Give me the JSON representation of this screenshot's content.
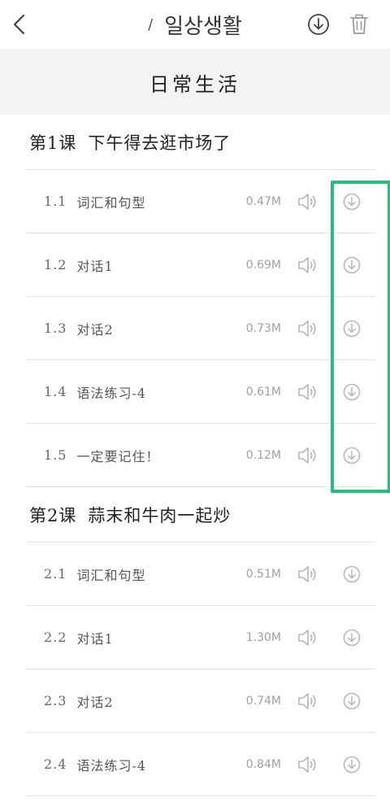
{
  "header": {
    "title": "일상생활",
    "slash": "/",
    "back_icon": "chevron-left-icon",
    "download_icon": "download-icon",
    "trash_icon": "trash-icon"
  },
  "book_title": "日常生活",
  "lessons": [
    {
      "title_num": "第1课",
      "title_text": "下午得去逛市场了",
      "items": [
        {
          "num": "1.1",
          "label": "词汇和句型",
          "size": "0.47M"
        },
        {
          "num": "1.2",
          "label": "对话1",
          "size": "0.69M"
        },
        {
          "num": "1.3",
          "label": "对话2",
          "size": "0.73M"
        },
        {
          "num": "1.4",
          "label": "语法练习-4",
          "size": "0.61M"
        },
        {
          "num": "1.5",
          "label": "一定要记住！",
          "size": "0.12M"
        }
      ]
    },
    {
      "title_num": "第2课",
      "title_text": "蒜末和牛肉一起炒",
      "items": [
        {
          "num": "2.1",
          "label": "词汇和句型",
          "size": "0.51M"
        },
        {
          "num": "2.2",
          "label": "对话1",
          "size": "1.30M"
        },
        {
          "num": "2.3",
          "label": "对话2",
          "size": "0.74M"
        },
        {
          "num": "2.4",
          "label": "语法练习-4",
          "size": "0.84M"
        }
      ]
    }
  ],
  "colors": {
    "highlight": "#22c07a",
    "banner_bg": "#f3f3f3",
    "icon_gray": "#b5b5b5"
  }
}
